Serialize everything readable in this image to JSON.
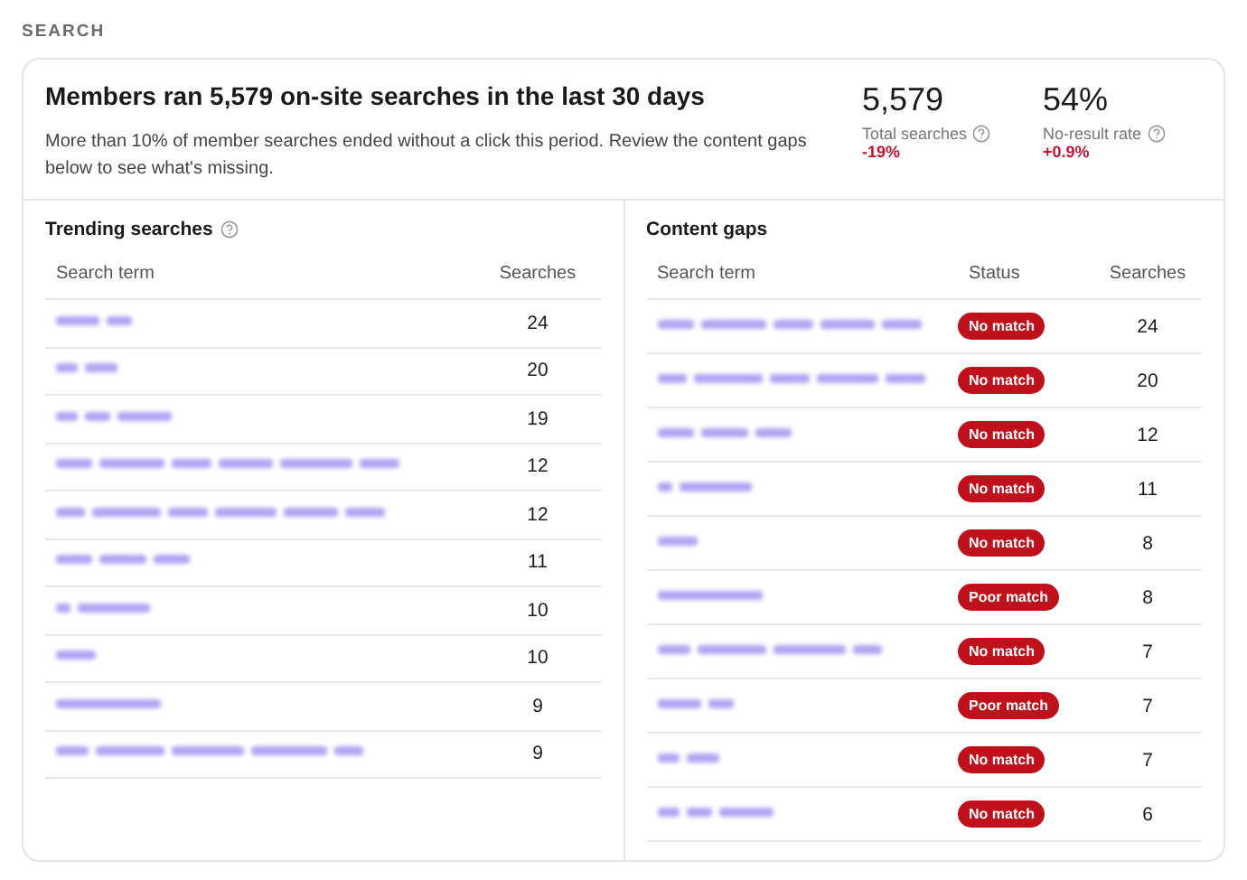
{
  "section_label": "SEARCH",
  "summary": {
    "title": "Members ran 5,579 on-site searches in the last 30 days",
    "description": "More than 10% of member searches ended without a click this period. Review the content gaps below to see what's missing.",
    "stats": [
      {
        "value": "5,579",
        "label": "Total searches",
        "change": "-19%"
      },
      {
        "value": "54%",
        "label": "No-result rate",
        "change": "+0.9%"
      }
    ]
  },
  "trending": {
    "title": "Trending searches",
    "columns": [
      "Search term",
      "Searches"
    ],
    "rows": [
      {
        "searches": "24"
      },
      {
        "searches": "20"
      },
      {
        "searches": "19"
      },
      {
        "searches": "12"
      },
      {
        "searches": "12"
      },
      {
        "searches": "11"
      },
      {
        "searches": "10"
      },
      {
        "searches": "10"
      },
      {
        "searches": "9"
      },
      {
        "searches": "9"
      }
    ]
  },
  "gaps": {
    "title": "Content gaps",
    "columns": [
      "Search term",
      "Status",
      "Searches"
    ],
    "rows": [
      {
        "status": "No match",
        "searches": "24"
      },
      {
        "status": "No match",
        "searches": "20"
      },
      {
        "status": "No match",
        "searches": "12"
      },
      {
        "status": "No match",
        "searches": "11"
      },
      {
        "status": "No match",
        "searches": "8"
      },
      {
        "status": "Poor match",
        "searches": "8"
      },
      {
        "status": "No match",
        "searches": "7"
      },
      {
        "status": "Poor match",
        "searches": "7"
      },
      {
        "status": "No match",
        "searches": "7"
      },
      {
        "status": "No match",
        "searches": "6"
      }
    ]
  }
}
